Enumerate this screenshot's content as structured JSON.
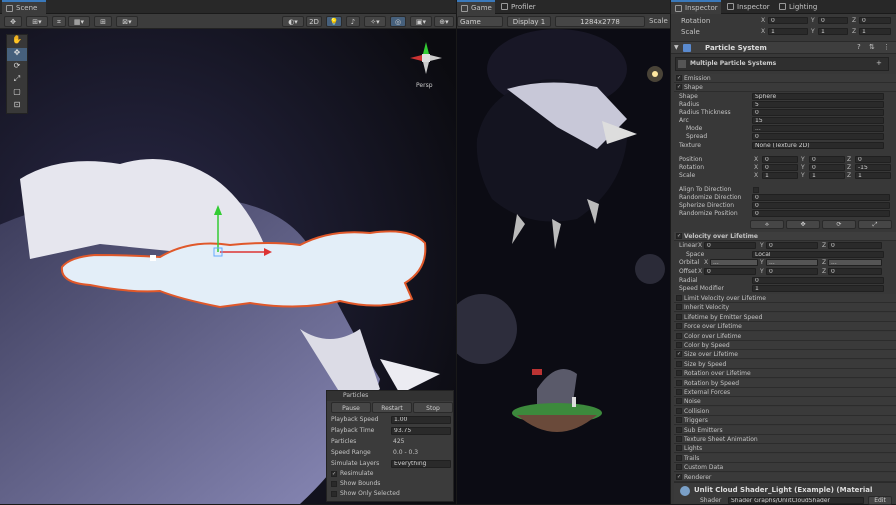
{
  "scene": {
    "tab": "Scene",
    "toolbar": {
      "mode_2d": "2D",
      "gizmo_persp": "Persp"
    }
  },
  "game": {
    "tabs": [
      "Game",
      "Profiler"
    ],
    "display_label": "Game",
    "display": "Display 1",
    "resolution": "1284x2778",
    "scale": "Scale"
  },
  "particles_overlay": {
    "title": "Particles",
    "buttons": [
      "Pause",
      "Restart",
      "Stop"
    ],
    "rows": [
      {
        "label": "Playback Speed",
        "value": "1.00"
      },
      {
        "label": "Playback Time",
        "value": "93.75"
      },
      {
        "label": "Particles",
        "value": "425"
      },
      {
        "label": "Speed Range",
        "value": "0.0 - 0.3"
      },
      {
        "label": "Simulate Layers",
        "value": "Everything"
      }
    ],
    "checks": [
      {
        "label": "Resimulate",
        "checked": true
      },
      {
        "label": "Show Bounds",
        "checked": false
      },
      {
        "label": "Show Only Selected",
        "checked": false
      }
    ]
  },
  "inspector": {
    "tabs": [
      "Inspector",
      "Inspector",
      "Lighting"
    ],
    "transform": {
      "rotation_label": "Rotation",
      "scale_label": "Scale",
      "rotation": {
        "x": "0",
        "y": "0",
        "z": "0"
      },
      "scale": {
        "x": "1",
        "y": "1",
        "z": "1"
      }
    },
    "component": "Particle System",
    "header": "Multiple Particle Systems",
    "top_modules": [
      "Emission",
      "Shape"
    ],
    "shape": [
      {
        "label": "Shape",
        "value": "Sphere"
      },
      {
        "label": "Radius",
        "value": "5"
      },
      {
        "label": "Radius Thickness",
        "value": "0"
      },
      {
        "label": "Arc",
        "value": "15"
      },
      {
        "label": "Mode",
        "value": "..."
      },
      {
        "label": "Spread",
        "value": "0"
      },
      {
        "label": "Texture",
        "value": "None (Texture 2D)"
      }
    ],
    "position": {
      "label": "Position",
      "x": "0",
      "y": "0",
      "z": "0"
    },
    "rotation": {
      "label": "Rotation",
      "x": "0",
      "y": "0",
      "z": "-15"
    },
    "scale": {
      "label": "Scale",
      "x": "1",
      "y": "1",
      "z": "1"
    },
    "shape2": [
      {
        "label": "Align To Direction",
        "value": ""
      },
      {
        "label": "Randomize Direction",
        "value": "0"
      },
      {
        "label": "Spherize Direction",
        "value": "0"
      },
      {
        "label": "Randomize Position",
        "value": "0"
      }
    ],
    "velocity": {
      "title": "Velocity over Lifetime",
      "linear": {
        "label": "Linear",
        "x": "0",
        "y": "0",
        "z": "0"
      },
      "space": {
        "label": "Space",
        "value": "Local"
      },
      "orbital": {
        "label": "Orbital",
        "x": "...",
        "y": "...",
        "z": "..."
      },
      "offset": {
        "label": "Offset",
        "x": "0",
        "y": "0",
        "z": "0"
      },
      "radial": {
        "label": "Radial",
        "value": "0"
      },
      "speed_mod": {
        "label": "Speed Modifier",
        "value": "1"
      }
    },
    "modules": [
      {
        "name": "Limit Velocity over Lifetime",
        "on": false
      },
      {
        "name": "Inherit Velocity",
        "on": false
      },
      {
        "name": "Lifetime by Emitter Speed",
        "on": false
      },
      {
        "name": "Force over Lifetime",
        "on": false
      },
      {
        "name": "Color over Lifetime",
        "on": false
      },
      {
        "name": "Color by Speed",
        "on": false
      },
      {
        "name": "Size over Lifetime",
        "on": true
      },
      {
        "name": "Size by Speed",
        "on": false
      },
      {
        "name": "Rotation over Lifetime",
        "on": false
      },
      {
        "name": "Rotation by Speed",
        "on": false
      },
      {
        "name": "External Forces",
        "on": false
      },
      {
        "name": "Noise",
        "on": false
      },
      {
        "name": "Collision",
        "on": false
      },
      {
        "name": "Triggers",
        "on": false
      },
      {
        "name": "Sub Emitters",
        "on": false
      },
      {
        "name": "Texture Sheet Animation",
        "on": false
      },
      {
        "name": "Lights",
        "on": false
      },
      {
        "name": "Trails",
        "on": false
      },
      {
        "name": "Custom Data",
        "on": false
      },
      {
        "name": "Renderer",
        "on": true
      }
    ],
    "material": {
      "name": "Unlit Cloud Shader_Light (Example) (Material",
      "shader_label": "Shader",
      "shader": "Shader Graphs/UnlitCloudShader",
      "edit": "Edit"
    }
  }
}
